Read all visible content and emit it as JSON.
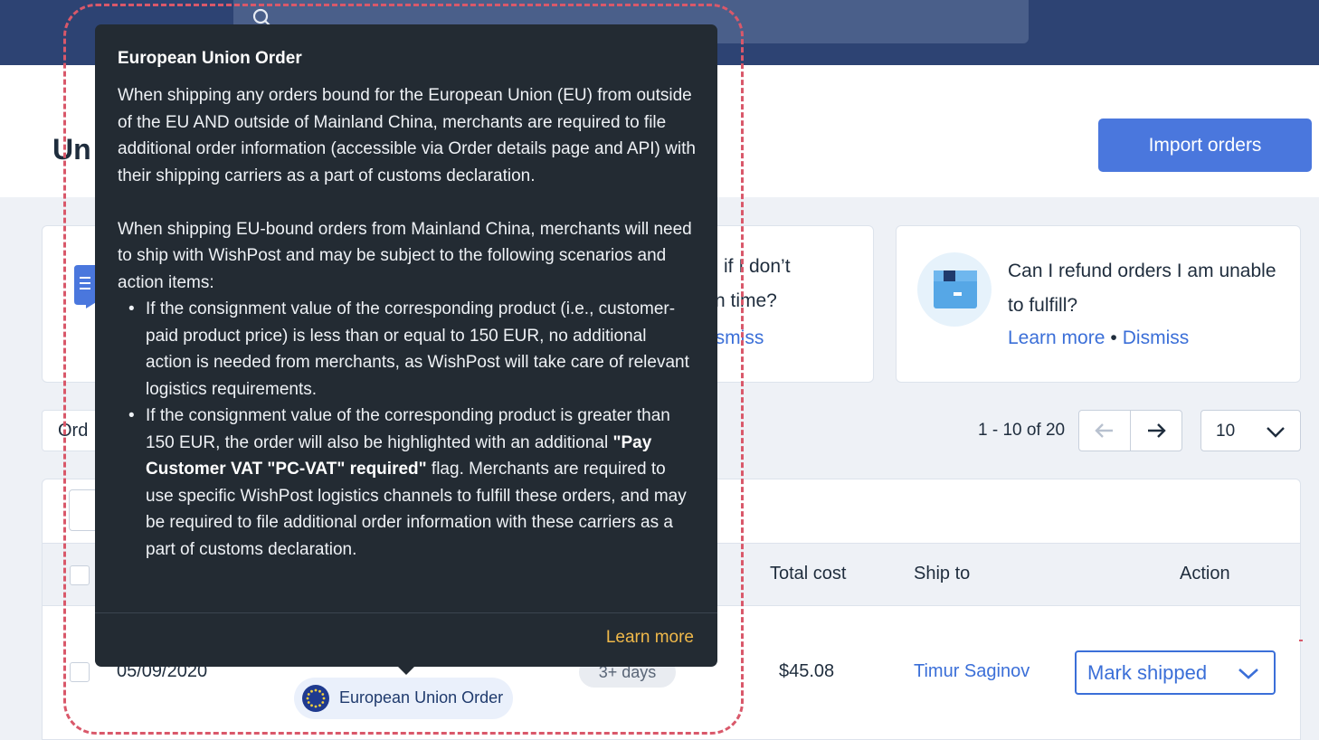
{
  "header": {
    "page_title_partial": "Un",
    "import_button": "Import orders"
  },
  "cards": {
    "card2_line1": "if I don’t",
    "card2_line2": "n time?",
    "card2_dismiss": "ismiss",
    "refund_question": "Can I refund orders I am unable to fulfill?",
    "refund_learn_more": "Learn more",
    "refund_separator": "•",
    "refund_dismiss": "Dismiss"
  },
  "filters": {
    "order_partial": "Ord"
  },
  "pagination": {
    "range_text": "1 - 10 of 20",
    "per_page": "10"
  },
  "table": {
    "headers": {
      "total_cost": "Total cost",
      "ship_to": "Ship to",
      "action": "Action"
    },
    "row": {
      "date": "05/09/2020",
      "days": "3+ days",
      "total_cost": "$45.08",
      "ship_to": "Timur Saginov",
      "action": "Mark shipped",
      "badge": "European Union Order"
    }
  },
  "tooltip": {
    "title": "European Union Order",
    "para1": "When shipping any orders bound for the European Union (EU) from outside of the EU AND outside of Mainland China, merchants are required to file additional order information (accessible via Order details page and API) with their shipping carriers as a part of customs declaration.",
    "para2": "When shipping EU-bound orders from Mainland China, merchants will need to ship with WishPost and may be subject to the following scenarios and action items:",
    "bullet1": "If the consignment value of the corresponding product (i.e., customer-paid product price) is less than or equal to 150 EUR, no additional action is needed from merchants, as WishPost will take care of relevant logistics requirements.",
    "bullet2_pre": "If the consignment value of the corresponding product is greater than 150 EUR, the order will also be highlighted with an additional ",
    "bullet2_bold": "\"Pay Customer VAT \"PC-VAT\" required\"",
    "bullet2_post": " flag. Merchants are required to use specific WishPost logistics channels to fulfill these orders, and may be required to file additional order information with these carriers as a part of customs declaration.",
    "learn_more": "Learn more"
  },
  "colors": {
    "topbar": "#2d4373",
    "primary": "#4a77dd",
    "link": "#3b6fd8",
    "tooltip_bg": "#232b33",
    "tooltip_link": "#f0b94a",
    "highlight_outline": "#d9586a"
  },
  "icons": {
    "search": "search-icon",
    "document": "document-icon",
    "package": "package-icon",
    "arrow_left": "arrow-left-icon",
    "arrow_right": "arrow-right-icon",
    "chevron_down": "chevron-down-icon",
    "eu_flag": "eu-flag-icon"
  }
}
